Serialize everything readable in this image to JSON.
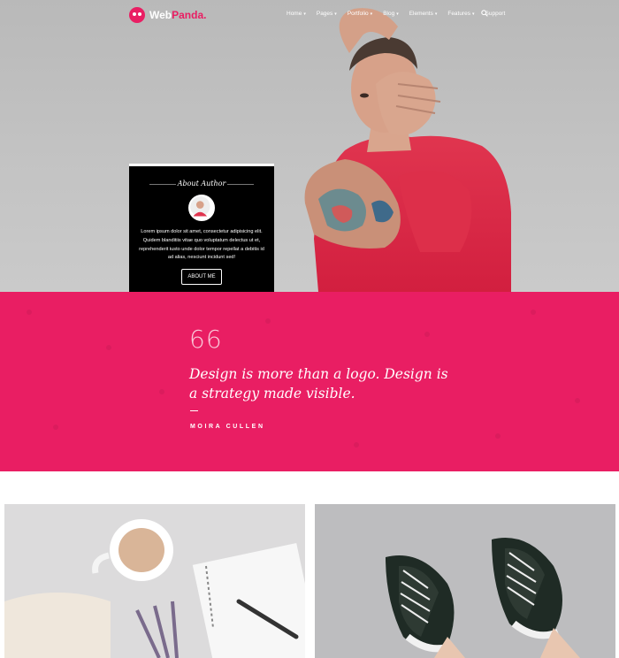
{
  "brand": {
    "name_part1": "Web",
    "name_part2": "Panda."
  },
  "nav": {
    "items": [
      {
        "label": "Home",
        "caret": "▾"
      },
      {
        "label": "Pages",
        "caret": "▾"
      },
      {
        "label": "Portfolio",
        "caret": "▾"
      },
      {
        "label": "Blog",
        "caret": "▾"
      },
      {
        "label": "Elements",
        "caret": "▾"
      },
      {
        "label": "Features",
        "caret": "▾"
      },
      {
        "label": "Support",
        "caret": ""
      }
    ]
  },
  "author_card": {
    "heading": "About Author",
    "text": "Lorem ipsum dolor sit amet, consectetur adipisicing elit. Quidem blanditiis vitae quo voluptatum delectus ut et, reprehenderit iusto unde dolor tempor repellat a debitis id ad alias, nesciunt incidunt sed!",
    "button_label": "ABOUT ME"
  },
  "quote": {
    "mark": "66",
    "text": "Design is more than a logo. Design is a strategy made visible.",
    "author": "MOIRA CULLEN"
  },
  "colors": {
    "accent": "#e91e63",
    "card": "#000000"
  },
  "icons": {
    "search": "search-icon",
    "logo": "panda-logo-icon"
  }
}
